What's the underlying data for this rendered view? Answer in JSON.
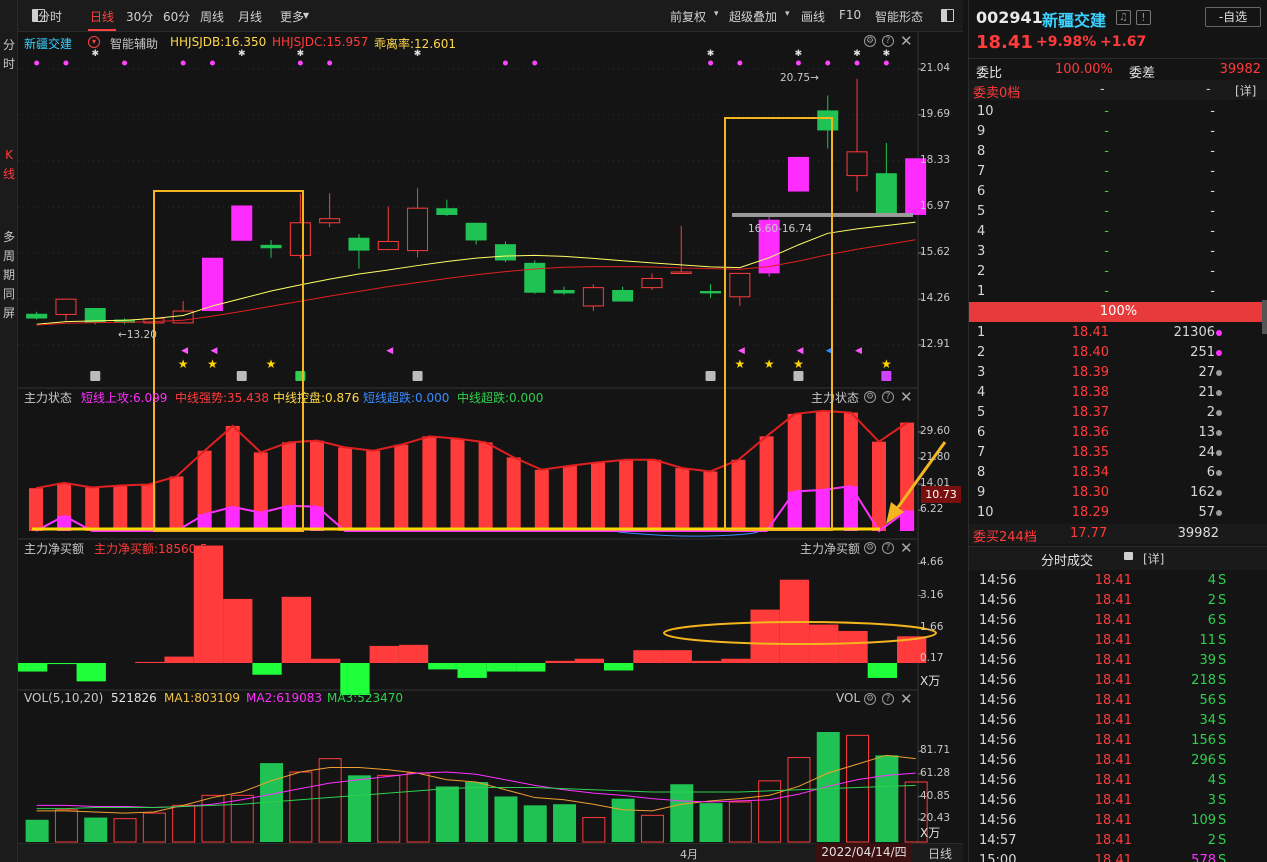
{
  "left_tabs": [
    {
      "label": "分时",
      "active": false
    },
    {
      "label": "K线",
      "active": true
    },
    {
      "label": "多周期同屏",
      "active": false
    }
  ],
  "toolbar": {
    "left_items": [
      "分时",
      "日线",
      "30分",
      "60分",
      "周线",
      "月线",
      "更多"
    ],
    "active": "日线",
    "right_items": [
      "前复权",
      "超级叠加",
      "画线",
      "F10",
      "智能形态"
    ]
  },
  "kpanel": {
    "stock_name": "新疆交建",
    "assist": "智能辅助",
    "hhjsjdb": "HHJSJDB:16.350",
    "hhjsjdc": "HHJSJDC:15.957",
    "bias": "乖离率:12.601",
    "axis": [
      "21.04",
      "19.69",
      "18.33",
      "16.97",
      "15.62",
      "14.26",
      "12.91"
    ],
    "high_label": "20.75",
    "low_label": "13.20",
    "band_label": "16.60-16.74"
  },
  "zlzt": {
    "title": "主力状态",
    "short_up": "短线上攻:6.099",
    "mid_strong": "中线强势:35.438",
    "mid_consol": "中线控盘:0.876",
    "short_over": "短线超跌:0.000",
    "mid_over": "中线超跌:0.000",
    "axis": [
      "29.60",
      "21.80",
      "14.01",
      "6.22"
    ],
    "current": "10.73"
  },
  "jme": {
    "title": "主力净买额",
    "value": "主力净买额:18560.5",
    "axis": [
      "4.66",
      "3.16",
      "1.66",
      "0.17"
    ],
    "unit": "X万"
  },
  "vol": {
    "title": "VOL(5,10,20)",
    "value": "521826",
    "ma1": "MA1:803109",
    "ma2": "MA2:619083",
    "ma3": "MA3:523470",
    "right_title": "VOL",
    "axis": [
      "81.71",
      "61.28",
      "40.85",
      "20.43"
    ],
    "unit": "X万"
  },
  "footer": {
    "month": "4月",
    "date": "2022/04/14/四",
    "period": "日线"
  },
  "colors": {
    "up": "#ff3b3b",
    "down": "#1fc253",
    "limit_up": "#ff2cff",
    "ma_short": "#ffff66",
    "ma_long": "#e02020",
    "box": "#f5b51e"
  },
  "quote": {
    "code": "002941",
    "name": "新疆交建",
    "price": "18.41",
    "change_pct": "+9.98%",
    "change": "+1.67",
    "self_select": "-自选",
    "weibi_label": "委比",
    "weibi": "100.00%",
    "weicha_label": "委差",
    "weicha": "39982",
    "sell_header": "委卖0档",
    "sell_dash1": "-",
    "sell_dash2": "-",
    "detail": "[详]",
    "buy_ratio": "100%",
    "buy_footer": {
      "label": "委买244档",
      "price": "17.77",
      "vol": "39982"
    },
    "trades_title": "分时成交"
  },
  "sell_rows": [
    {
      "lvl": "10",
      "price": "-",
      "vol": "-"
    },
    {
      "lvl": "9",
      "price": "-",
      "vol": "-"
    },
    {
      "lvl": "8",
      "price": "-",
      "vol": "-"
    },
    {
      "lvl": "7",
      "price": "-",
      "vol": "-"
    },
    {
      "lvl": "6",
      "price": "-",
      "vol": "-"
    },
    {
      "lvl": "5",
      "price": "-",
      "vol": "-"
    },
    {
      "lvl": "4",
      "price": "-",
      "vol": "-"
    },
    {
      "lvl": "3",
      "price": "-",
      "vol": "-"
    },
    {
      "lvl": "2",
      "price": "-",
      "vol": "-"
    },
    {
      "lvl": "1",
      "price": "-",
      "vol": "-"
    }
  ],
  "buy_rows": [
    {
      "lvl": "1",
      "price": "18.41",
      "vol": "21306",
      "dot": "#ff30ff"
    },
    {
      "lvl": "2",
      "price": "18.40",
      "vol": "251",
      "dot": "#ff30ff"
    },
    {
      "lvl": "3",
      "price": "18.39",
      "vol": "27",
      "dot": "#9a9a9a"
    },
    {
      "lvl": "4",
      "price": "18.38",
      "vol": "21",
      "dot": "#9a9a9a"
    },
    {
      "lvl": "5",
      "price": "18.37",
      "vol": "2",
      "dot": "#9a9a9a"
    },
    {
      "lvl": "6",
      "price": "18.36",
      "vol": "13",
      "dot": "#9a9a9a"
    },
    {
      "lvl": "7",
      "price": "18.35",
      "vol": "24",
      "dot": "#9a9a9a"
    },
    {
      "lvl": "8",
      "price": "18.34",
      "vol": "6",
      "dot": "#9a9a9a"
    },
    {
      "lvl": "9",
      "price": "18.30",
      "vol": "162",
      "dot": "#9a9a9a"
    },
    {
      "lvl": "10",
      "price": "18.29",
      "vol": "57",
      "dot": "#9a9a9a"
    }
  ],
  "trades": [
    {
      "time": "14:56",
      "price": "18.41",
      "vol": "4",
      "side": "S"
    },
    {
      "time": "14:56",
      "price": "18.41",
      "vol": "2",
      "side": "S"
    },
    {
      "time": "14:56",
      "price": "18.41",
      "vol": "6",
      "side": "S"
    },
    {
      "time": "14:56",
      "price": "18.41",
      "vol": "11",
      "side": "S"
    },
    {
      "time": "14:56",
      "price": "18.41",
      "vol": "39",
      "side": "S"
    },
    {
      "time": "14:56",
      "price": "18.41",
      "vol": "218",
      "side": "S"
    },
    {
      "time": "14:56",
      "price": "18.41",
      "vol": "56",
      "side": "S"
    },
    {
      "time": "14:56",
      "price": "18.41",
      "vol": "34",
      "side": "S"
    },
    {
      "time": "14:56",
      "price": "18.41",
      "vol": "156",
      "side": "S"
    },
    {
      "time": "14:56",
      "price": "18.41",
      "vol": "296",
      "side": "S"
    },
    {
      "time": "14:56",
      "price": "18.41",
      "vol": "4",
      "side": "S"
    },
    {
      "time": "14:56",
      "price": "18.41",
      "vol": "3",
      "side": "S"
    },
    {
      "time": "14:56",
      "price": "18.41",
      "vol": "109",
      "side": "S"
    },
    {
      "time": "14:57",
      "price": "18.41",
      "vol": "2",
      "side": "S"
    },
    {
      "time": "15:00",
      "price": "18.41",
      "vol": "578",
      "side": "S"
    }
  ],
  "chart_data": {
    "type": "candlestick",
    "candles": [
      {
        "o": 13.83,
        "c": 13.69,
        "h": 13.89,
        "l": 13.66
      },
      {
        "o": 13.81,
        "c": 14.26,
        "h": 14.28,
        "l": 13.63
      },
      {
        "o": 14.0,
        "c": 13.56,
        "h": 14.0,
        "l": 13.52
      },
      {
        "o": 13.66,
        "c": 13.56,
        "h": 13.7,
        "l": 13.52
      },
      {
        "o": 13.56,
        "c": 13.69,
        "h": 14.39,
        "l": 13.23
      },
      {
        "o": 13.56,
        "c": 13.91,
        "h": 14.2,
        "l": 13.56
      },
      {
        "o": 13.91,
        "c": 15.48,
        "h": 15.48,
        "l": 13.91
      },
      {
        "o": 15.98,
        "c": 17.02,
        "h": 17.02,
        "l": 15.98
      },
      {
        "o": 15.86,
        "c": 15.76,
        "h": 16.0,
        "l": 15.48
      },
      {
        "o": 15.55,
        "c": 16.51,
        "h": 17.37,
        "l": 15.45
      },
      {
        "o": 16.51,
        "c": 16.63,
        "h": 17.38,
        "l": 16.38
      },
      {
        "o": 16.07,
        "c": 15.69,
        "h": 16.18,
        "l": 15.16
      },
      {
        "o": 15.72,
        "c": 15.96,
        "h": 16.99,
        "l": 15.72
      },
      {
        "o": 15.69,
        "c": 16.94,
        "h": 17.53,
        "l": 15.49
      },
      {
        "o": 16.94,
        "c": 16.74,
        "h": 17.19,
        "l": 16.71
      },
      {
        "o": 16.51,
        "c": 15.99,
        "h": 16.51,
        "l": 15.87
      },
      {
        "o": 15.88,
        "c": 15.4,
        "h": 15.96,
        "l": 15.35
      },
      {
        "o": 15.33,
        "c": 14.45,
        "h": 15.4,
        "l": 14.42
      },
      {
        "o": 14.53,
        "c": 14.43,
        "h": 14.63,
        "l": 14.39
      },
      {
        "o": 14.06,
        "c": 14.6,
        "h": 14.7,
        "l": 13.91
      },
      {
        "o": 14.53,
        "c": 14.19,
        "h": 14.63,
        "l": 14.19
      },
      {
        "o": 14.6,
        "c": 14.87,
        "h": 15.02,
        "l": 14.53
      },
      {
        "o": 15.06,
        "c": 15.06,
        "h": 16.42,
        "l": 15.06
      },
      {
        "o": 14.5,
        "c": 14.43,
        "h": 14.7,
        "l": 14.29
      },
      {
        "o": 14.33,
        "c": 15.02,
        "h": 15.02,
        "l": 14.06
      },
      {
        "o": 15.02,
        "c": 16.6,
        "h": 16.74,
        "l": 14.92
      },
      {
        "o": 17.43,
        "c": 18.45,
        "h": 18.45,
        "l": 17.43
      },
      {
        "o": 19.82,
        "c": 19.23,
        "h": 20.26,
        "l": 18.7
      },
      {
        "o": 17.9,
        "c": 18.6,
        "h": 20.75,
        "l": 17.43
      },
      {
        "o": 17.97,
        "c": 16.77,
        "h": 18.86,
        "l": 16.77
      },
      {
        "o": 16.74,
        "c": 18.41,
        "h": 18.41,
        "l": 16.74
      }
    ],
    "limit_up_index": [
      6,
      7,
      25,
      26,
      30
    ],
    "ma_short": [
      13.52,
      13.6,
      13.62,
      13.64,
      13.69,
      13.78,
      14.06,
      14.28,
      14.5,
      14.68,
      14.85,
      15.0,
      15.12,
      15.25,
      15.37,
      15.47,
      15.53,
      15.55,
      15.52,
      15.46,
      15.39,
      15.33,
      15.27,
      15.21,
      15.19,
      15.48,
      15.86,
      16.2,
      16.33,
      16.43,
      16.53
    ],
    "ma_long": [
      13.5,
      13.55,
      13.57,
      13.58,
      13.6,
      13.64,
      13.76,
      13.9,
      14.05,
      14.2,
      14.35,
      14.49,
      14.63,
      14.75,
      14.87,
      14.98,
      15.07,
      15.15,
      15.2,
      15.22,
      15.22,
      15.21,
      15.18,
      15.16,
      15.14,
      15.22,
      15.38,
      15.57,
      15.73,
      15.87,
      16.01
    ],
    "zlzt_red": [
      12.8,
      14.4,
      13.0,
      13.6,
      13.9,
      16.3,
      24.0,
      31.4,
      23.5,
      26.5,
      27.0,
      25.0,
      24.0,
      25.8,
      28.3,
      27.6,
      26.5,
      22.0,
      18.3,
      19.5,
      20.5,
      21.3,
      21.3,
      18.8,
      17.8,
      21.3,
      28.3,
      35.0,
      35.9,
      35.4,
      26.7,
      32.4
    ],
    "zlzt_mag": [
      0,
      4.5,
      0,
      0,
      0,
      0,
      5.0,
      7.2,
      5.5,
      7.5,
      7.3,
      0,
      0,
      0,
      0,
      0,
      0,
      0,
      0,
      0,
      0,
      0,
      0,
      0,
      0,
      0,
      0,
      11.8,
      12.3,
      13.4,
      0,
      6.1
    ],
    "jme": [
      -0.4,
      -0.05,
      -0.86,
      0.0,
      0.05,
      0.3,
      5.5,
      3.0,
      -0.55,
      3.1,
      0.2,
      -1.5,
      0.8,
      0.85,
      -0.3,
      -0.7,
      -0.4,
      -0.4,
      0.1,
      0.2,
      -0.35,
      0.6,
      0.6,
      0.1,
      0.2,
      2.5,
      3.9,
      1.8,
      1.5,
      -0.7,
      1.25
    ],
    "vol": [
      20.0,
      29.0,
      22.0,
      21.0,
      26.0,
      33.0,
      42.0,
      42.0,
      71.0,
      63.0,
      75.0,
      60.0,
      60.0,
      62.0,
      50.0,
      54.0,
      41.0,
      33.0,
      34.0,
      22.0,
      39.0,
      24.0,
      52.0,
      35.0,
      36.0,
      55.0,
      76.0,
      99.0,
      96.0,
      78.0,
      54.0
    ],
    "vol_up": [
      false,
      true,
      false,
      true,
      true,
      true,
      true,
      true,
      false,
      true,
      true,
      false,
      true,
      true,
      false,
      false,
      false,
      false,
      false,
      true,
      false,
      true,
      false,
      false,
      true,
      true,
      true,
      false,
      true,
      false,
      true
    ],
    "vol_ma1": [
      28,
      28,
      27,
      26,
      27,
      33,
      40,
      45,
      55,
      63,
      67,
      67,
      65,
      62,
      56,
      54,
      47,
      40,
      38,
      34,
      29,
      28,
      34,
      37,
      39,
      42,
      50,
      62,
      70,
      78,
      75
    ],
    "vol_ma2": [
      33,
      33,
      32,
      32,
      31,
      32,
      34,
      38,
      43,
      48,
      53,
      56,
      59,
      62,
      63,
      61,
      56,
      51,
      47,
      44,
      42,
      39,
      37,
      36,
      37,
      38,
      43,
      50,
      56,
      60,
      62
    ],
    "vol_ma3": [
      30,
      30,
      31,
      31,
      31,
      32,
      33,
      34,
      36,
      38,
      40,
      42,
      44,
      46,
      48,
      49,
      49,
      49,
      48,
      47,
      46,
      45,
      45,
      45,
      45,
      46,
      47,
      48,
      49,
      50,
      51
    ]
  }
}
